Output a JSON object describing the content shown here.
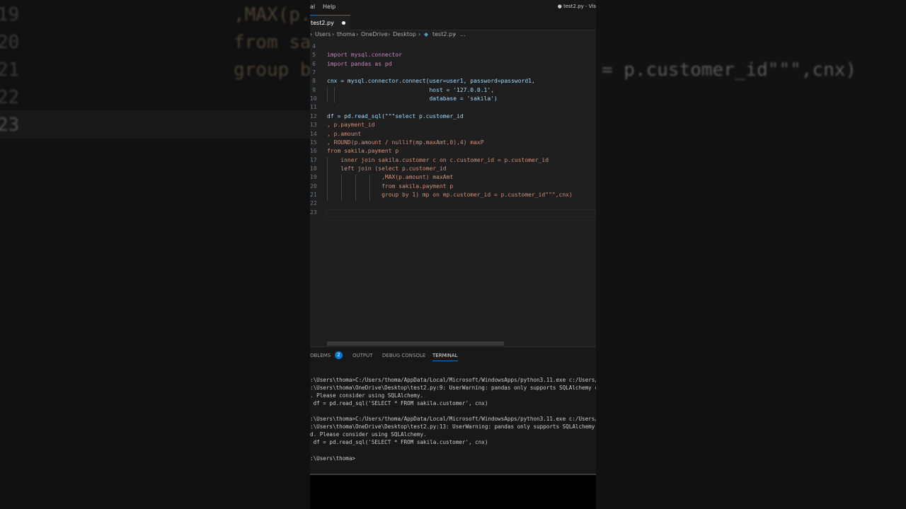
{
  "background_zoom": {
    "line_numbers": [
      "19",
      "20",
      "21",
      "22",
      "23"
    ],
    "code_lines": [
      ",MAX(p.",
      "from sa",
      "group b"
    ],
    "right_code": "= p.customer_id\"\"\",cnx)"
  },
  "titlebar": {
    "menu": [
      "al",
      "Help"
    ],
    "title": "● test2.py - Vis"
  },
  "tab": {
    "label": "test2.py"
  },
  "breadcrumb": [
    "Users",
    "thoma",
    "OneDrive",
    "Desktop",
    "test2.py",
    "..."
  ],
  "editor": {
    "line_numbers": [
      "4",
      "5",
      "6",
      "7",
      "8",
      "9",
      "10",
      "11",
      "12",
      "13",
      "14",
      "15",
      "16",
      "17",
      "18",
      "19",
      "20",
      "21",
      "22",
      "23"
    ],
    "lines": [
      "",
      "import mysql.connector",
      "import pandas as pd",
      "",
      "cnx = mysql.connector.connect(user=user1, password=password1,",
      "                              host = '127.0.0.1',",
      "                              database = 'sakila')",
      "",
      "df = pd.read_sql(\"\"\"select p.customer_id",
      ", p.payment_id",
      ", p.amount",
      ", ROUND(p.amount / nullif(mp.maxAmt,0),4) maxP",
      "from sakila.payment p",
      "    inner join sakila.customer c on c.customer_id = p.customer_id",
      "    left join (select p.customer_id",
      "                ,MAX(p.amount) maxAmt",
      "                from sakila.payment p",
      "                group by 1) mp on mp.customer_id = p.customer_id\"\"\",cnx)",
      "",
      ""
    ]
  },
  "panel": {
    "tabs": [
      "OBLEMS",
      "OUTPUT",
      "DEBUG CONSOLE",
      "TERMINAL"
    ],
    "problems_count": "2",
    "terminal_lines": [
      ":\\Users\\thoma>C:/Users/thoma/AppData/Local/Microsoft/WindowsApps/python3.11.exe c:/Users/t",
      ":\\Users\\thoma\\OneDrive\\Desktop\\test2.py:9: UserWarning: pandas only supports SQLAlchemy co",
      ". Please consider using SQLAlchemy.",
      " df = pd.read_sql('SELECT * FROM sakila.customer', cnx)",
      "",
      ":\\Users\\thoma>C:/Users/thoma/AppData/Local/Microsoft/WindowsApps/python3.11.exe c:/Users/t",
      ":\\Users\\thoma\\OneDrive\\Desktop\\test2.py:13: UserWarning: pandas only supports SQLAlchemy c",
      "d. Please consider using SQLAlchemy.",
      " df = pd.read_sql('SELECT * FROM sakila.customer', cnx)",
      "",
      ":\\Users\\thoma>"
    ]
  }
}
